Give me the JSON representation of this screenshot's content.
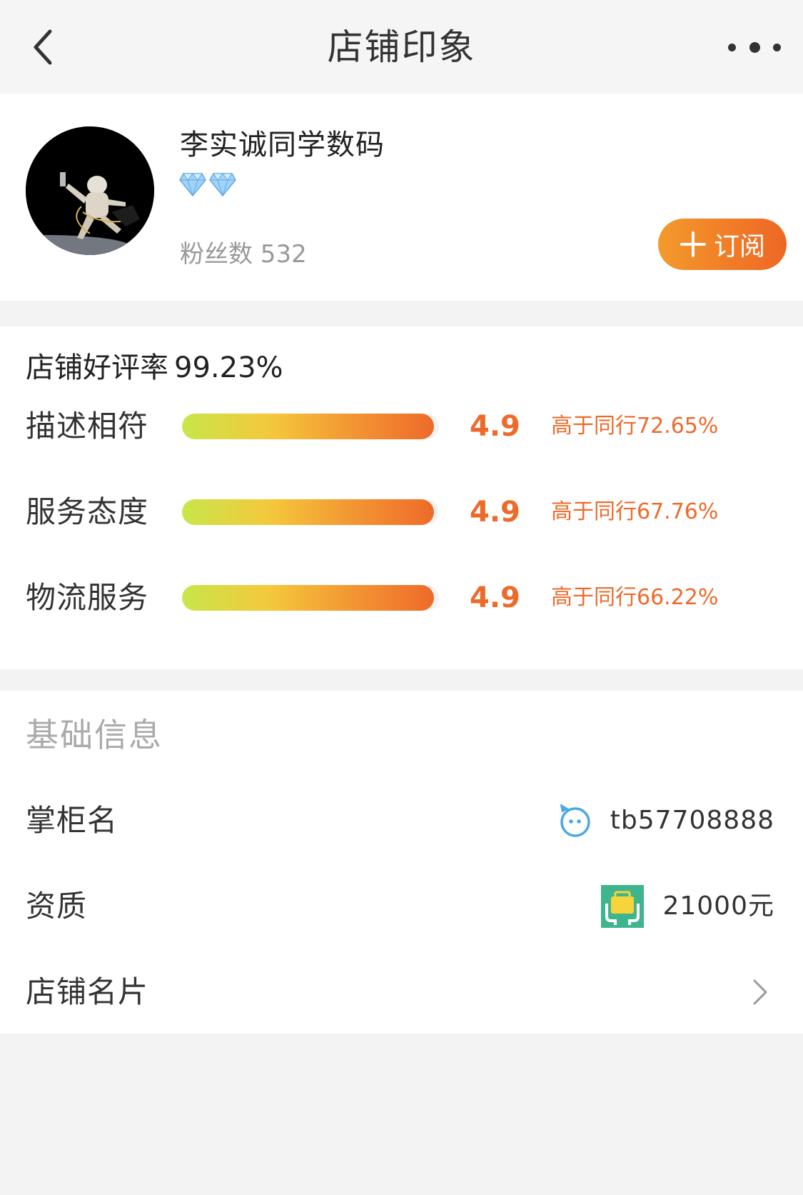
{
  "nav": {
    "title": "店铺印象",
    "back_icon": "chevron-left-icon",
    "more_icon": "more-dots-icon"
  },
  "shop": {
    "name": "李实诚同学数码",
    "level_icon": "diamond-icon",
    "level_count": 2,
    "fans": "粉丝数 532",
    "subscribe_label": "订阅",
    "subscribe_icon": "plus-icon"
  },
  "rating": {
    "good_rate_label": "店铺好评率",
    "good_rate_value": "99.23%",
    "metrics": [
      {
        "label": "描述相符",
        "score": "4.9",
        "compare": "高于同行72.65%",
        "fill_fraction": 0.98
      },
      {
        "label": "服务态度",
        "score": "4.9",
        "compare": "高于同行67.76%",
        "fill_fraction": 0.98
      },
      {
        "label": "物流服务",
        "score": "4.9",
        "compare": "高于同行66.22%",
        "fill_fraction": 0.98
      }
    ]
  },
  "info": {
    "title": "基础信息",
    "rows": [
      {
        "label": "掌柜名",
        "value": "tb57708888",
        "icon": "chat-face-icon"
      },
      {
        "label": "资质",
        "value": "21000元",
        "icon": "deposit-bag-icon"
      },
      {
        "label": "店铺名片",
        "value": "",
        "icon": "chevron-right-icon"
      }
    ]
  },
  "colors": {
    "accent": "#ee6a2a",
    "subscribe_gradient_start": "#f39a2c",
    "subscribe_gradient_end": "#ee6725",
    "bar_gradient": [
      "#c8e64a",
      "#f5c83c",
      "#f39a33",
      "#ee6a2a"
    ],
    "page_bg": "#f3f3f3"
  }
}
